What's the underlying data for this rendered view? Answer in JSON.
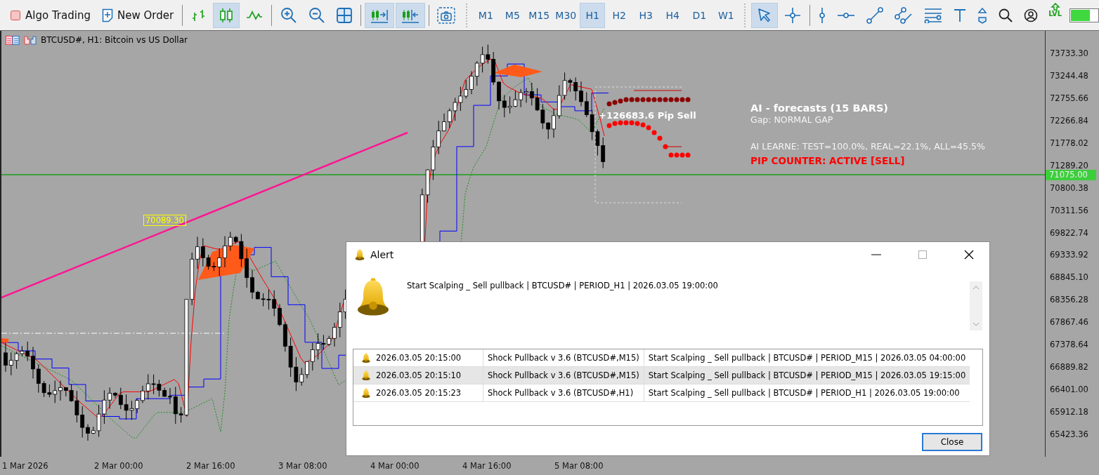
{
  "toolbar": {
    "items": [
      {
        "kind": "algo-trading",
        "label": "Algo Trading",
        "selected": false
      },
      {
        "kind": "new-order",
        "label": "New Order",
        "selected": false
      },
      {
        "kind": "separator"
      },
      {
        "kind": "bar-chart",
        "selected": false
      },
      {
        "kind": "candlesticks",
        "selected": true
      },
      {
        "kind": "line-chart",
        "selected": false
      },
      {
        "kind": "separator"
      },
      {
        "kind": "zoom-in",
        "selected": false
      },
      {
        "kind": "zoom-out",
        "selected": false
      },
      {
        "kind": "tile-windows",
        "selected": false
      },
      {
        "kind": "separator"
      },
      {
        "kind": "chart-shift",
        "selected": true
      },
      {
        "kind": "auto-scroll",
        "selected": true
      },
      {
        "kind": "separator"
      },
      {
        "kind": "screenshot",
        "selected": false
      },
      {
        "kind": "dotted-separator"
      },
      {
        "kind": "timeframe",
        "label": "M1",
        "selected": false
      },
      {
        "kind": "timeframe",
        "label": "M5",
        "selected": false
      },
      {
        "kind": "timeframe",
        "label": "M15",
        "selected": false
      },
      {
        "kind": "timeframe",
        "label": "M30",
        "selected": false
      },
      {
        "kind": "timeframe",
        "label": "H1",
        "selected": true
      },
      {
        "kind": "timeframe",
        "label": "H2",
        "selected": false
      },
      {
        "kind": "timeframe",
        "label": "H3",
        "selected": false
      },
      {
        "kind": "timeframe",
        "label": "H4",
        "selected": false
      },
      {
        "kind": "timeframe",
        "label": "D1",
        "selected": false
      },
      {
        "kind": "timeframe",
        "label": "W1",
        "selected": false
      },
      {
        "kind": "dotted-separator"
      },
      {
        "kind": "cursor",
        "selected": true
      },
      {
        "kind": "crosshair",
        "selected": false
      },
      {
        "kind": "separator"
      },
      {
        "kind": "vertical-line",
        "selected": false
      },
      {
        "kind": "horizontal-line",
        "selected": false
      },
      {
        "kind": "trend-line",
        "selected": false
      },
      {
        "kind": "channel",
        "selected": false
      },
      {
        "kind": "fibonacci",
        "selected": false
      },
      {
        "kind": "text-tool",
        "selected": false
      },
      {
        "kind": "arrows",
        "selected": false
      },
      {
        "kind": "search",
        "selected": false
      },
      {
        "kind": "account",
        "selected": false
      },
      {
        "kind": "lvl",
        "label": "LVL",
        "selected": false
      },
      {
        "kind": "meter",
        "level": 0.72
      }
    ]
  },
  "chart": {
    "title": "BTCUSD#, H1:  Bitcoin vs US Dollar",
    "price_labels": [
      "73733.30",
      "73244.48",
      "72755.66",
      "72266.84",
      "71778.02",
      "71289.20",
      "70800.38",
      "70311.56",
      "69822.74",
      "69333.92",
      "68845.10",
      "68356.28",
      "67867.46",
      "67378.64",
      "66889.82",
      "66401.00",
      "65912.18",
      "65423.36"
    ],
    "current_price": "71075.00",
    "time_labels": [
      "1 Mar 2026",
      "2 Mar 00:00",
      "2 Mar 16:00",
      "3 Mar 08:00",
      "4 Mar 00:00",
      "4 Mar 16:00",
      "5 Mar 08:00"
    ],
    "price_marker": "70089.30",
    "signal": "+126683.6 Pip Sell",
    "forecast": {
      "title": "AI - forecasts (15 BARS)",
      "gap": "Gap: NORMAL GAP",
      "learning": "AI LEARNE: TEST=100.0%, REAL=22.1%, ALL=45.5%",
      "counter": "PIP COUNTER: ACTIVE [SELL]"
    }
  },
  "alert": {
    "title": "Alert",
    "message": "Start Scalping _ Sell pullback | BTCUSD# | PERIOD_H1 | 2026.03.05 19:00:00",
    "rows": [
      {
        "time": "2026.03.05 20:15:00",
        "source": "Shock Pullback v 3.6 (BTCUSD#,M15)",
        "message": "Start Scalping _ Sell pullback | BTCUSD# | PERIOD_M15 | 2026.03.05 04:00:00",
        "selected": false
      },
      {
        "time": "2026.03.05 20:15:10",
        "source": "Shock Pullback v 3.6 (BTCUSD#,M15)",
        "message": "Start Scalping _ Sell pullback | BTCUSD# | PERIOD_M15 | 2026.03.05 19:15:00",
        "selected": true
      },
      {
        "time": "2026.03.05 20:15:23",
        "source": "Shock Pullback v 3.6 (BTCUSD#,H1)",
        "message": "Start Scalping _ Sell pullback | BTCUSD# | PERIOD_H1 | 2026.03.05 19:00:00",
        "selected": false
      }
    ],
    "close_button": "Close"
  }
}
